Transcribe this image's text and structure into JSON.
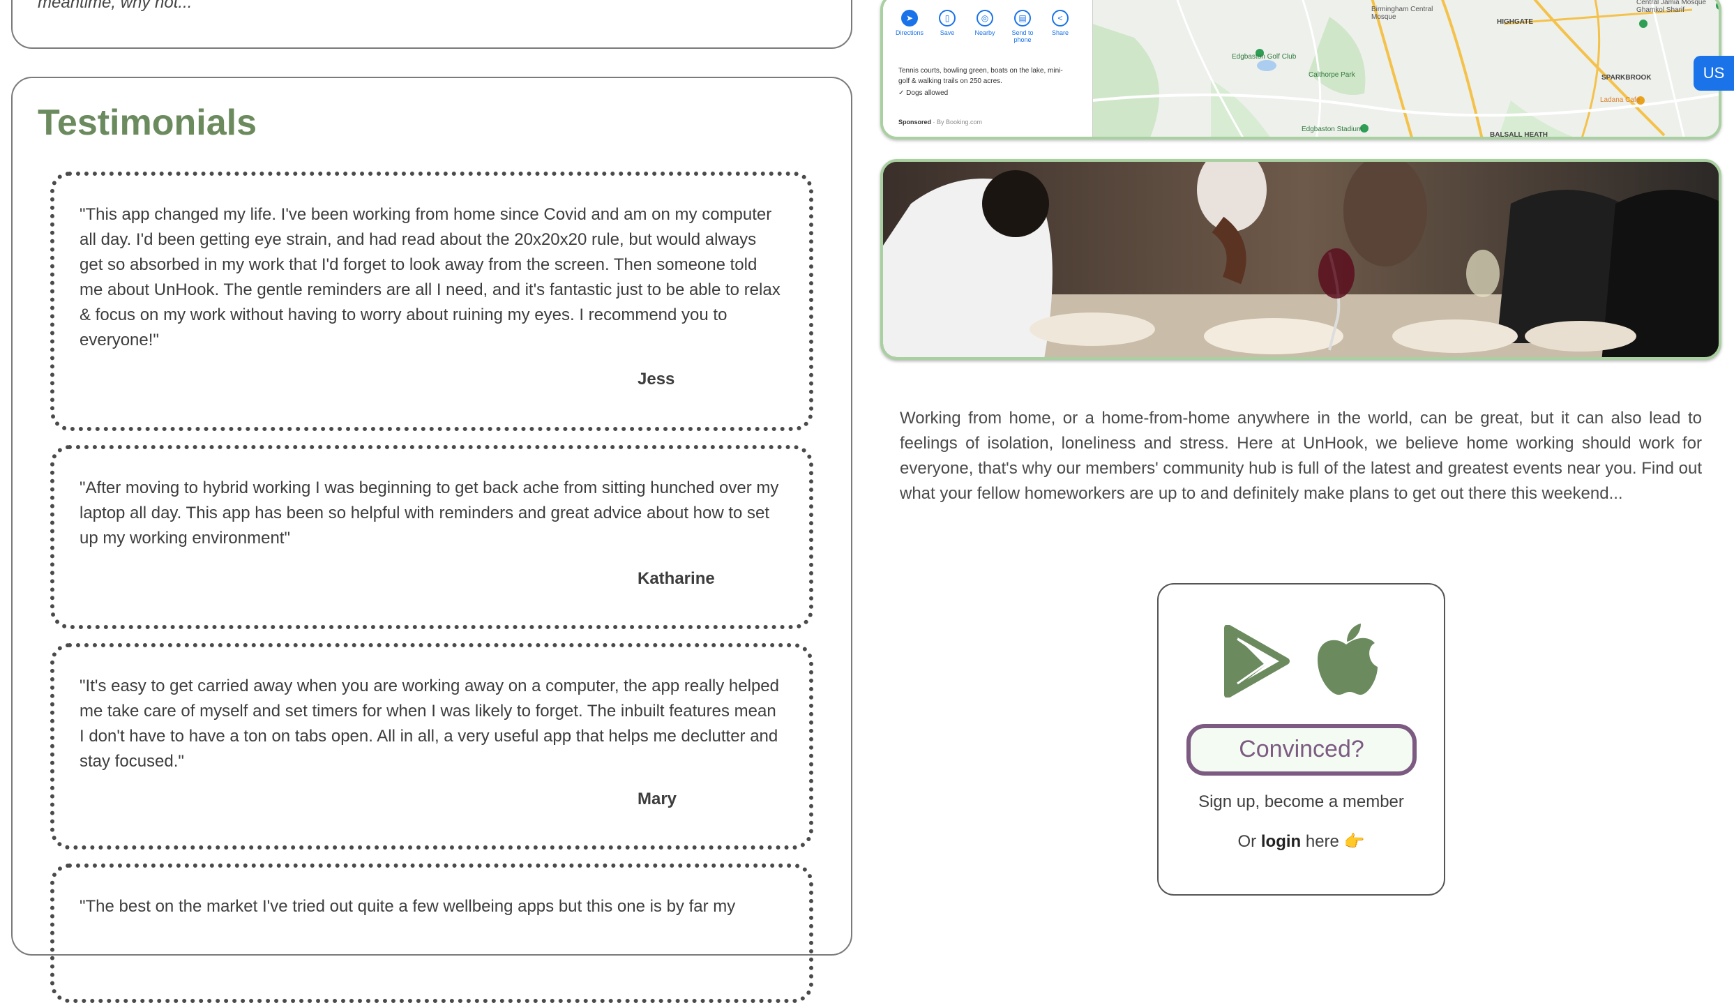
{
  "top_card": {
    "snippet": "meantime, why not..."
  },
  "testimonials": {
    "title": "Testimonials",
    "items": [
      {
        "quote": "\"This app changed my life. I've been working from home since Covid and am on my computer all day. I'd been getting eye strain, and had read about the 20x20x20 rule, but would always get so absorbed in my work that I'd forget to look away from the screen. Then someone told me about UnHook. The gentle reminders are all I need, and it's fantastic just to be able to relax & focus on my work without having to worry about ruining my eyes. I recommend you to everyone!\"",
        "author": "Jess"
      },
      {
        "quote": "\"After moving to hybrid working I was beginning to get back ache from sitting hunched over my laptop all day. This app has been so helpful with reminders and great advice about how to set up my working environment\"",
        "author": "Katharine"
      },
      {
        "quote": "\"It's easy to get carried away when you are working away on a computer, the app really helped me take care of myself and set timers for when I was likely to forget. The inbuilt features mean I don't have to have a ton on tabs open. All in all, a very useful app that helps me declutter and stay focused.\"",
        "author": "Mary"
      },
      {
        "quote": "\"The best on the market I've tried out quite a few wellbeing apps but this one is by far my",
        "author": ""
      }
    ]
  },
  "map": {
    "actions": [
      {
        "label": "Directions",
        "icon": "directions-icon"
      },
      {
        "label": "Save",
        "icon": "bookmark-icon"
      },
      {
        "label": "Nearby",
        "icon": "nearby-icon"
      },
      {
        "label": "Send to phone",
        "icon": "phone-icon"
      },
      {
        "label": "Share",
        "icon": "share-icon"
      }
    ],
    "description": "Tennis courts, bowling green, boats on the lake, mini-golf & walking trails on 250 acres.",
    "dogs": "✓ Dogs allowed",
    "sponsored": "Sponsored",
    "sponsored_by": "· By Booking.com",
    "labels": {
      "golf": "Edgbaston Golf Club",
      "calthorpe": "Calthorpe Park",
      "stadium": "Edgbaston Stadium",
      "balsall": "BALSALL HEATH",
      "highgate": "HIGHGATE",
      "mosque": "Birmingham Central Mosque",
      "sparkbrook": "SPARKBROOK",
      "ladana": "Ladana Cafe",
      "jamia": "Central Jamia Mosque Ghamkol Sharif"
    },
    "accent_color": "#1a73e8"
  },
  "us_badge": "US",
  "about": {
    "text": "Working from home, or a home-from-home anywhere in the world, can be great, but it can also lead to feelings of isolation, loneliness and stress. Here at UnHook, we believe home working should work for everyone, that's why our members' community hub is full of the latest and greatest events near you. Find out what your fellow homeworkers are up to and definitely make plans to get out there this weekend..."
  },
  "cta": {
    "button": "Convinced?",
    "signup": "Sign up, become a member",
    "login_prefix": "Or",
    "login_link": "login",
    "login_suffix": "here",
    "pointing_emoji": "👉"
  },
  "colors": {
    "heading_green": "#6b8a5e",
    "frame_green": "#a9d0a0",
    "button_purple": "#7c5a82",
    "icon_green": "#6b8a5e"
  }
}
